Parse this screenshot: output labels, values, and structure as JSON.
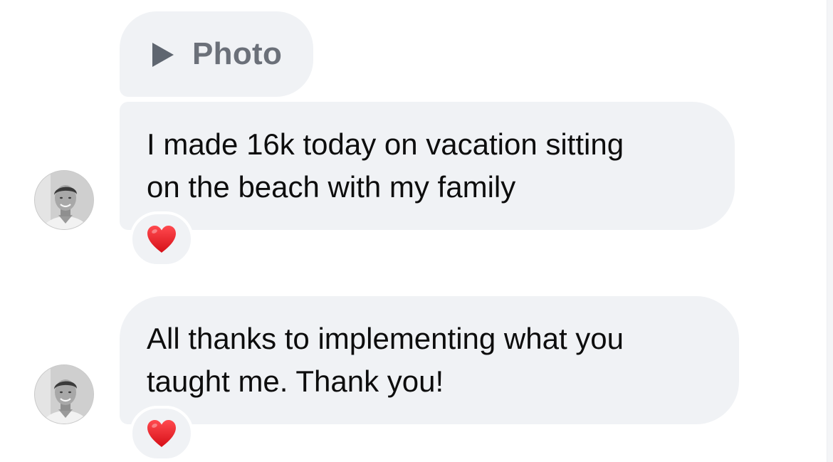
{
  "attachment": {
    "icon": "play-icon",
    "label": "Photo"
  },
  "messages": [
    {
      "lines": [
        "I made 16k today on vacation sitting",
        "on the beach with my family"
      ],
      "reaction": "heart-icon",
      "avatar": "avatar"
    },
    {
      "lines": [
        "All thanks to implementing what you",
        "taught me. Thank you!"
      ],
      "reaction": "heart-icon",
      "avatar": "avatar"
    }
  ],
  "colors": {
    "bubble": "#f0f2f5",
    "text": "#0d0d0d",
    "photo_label": "#6b7079",
    "heart": "#e8141c"
  }
}
